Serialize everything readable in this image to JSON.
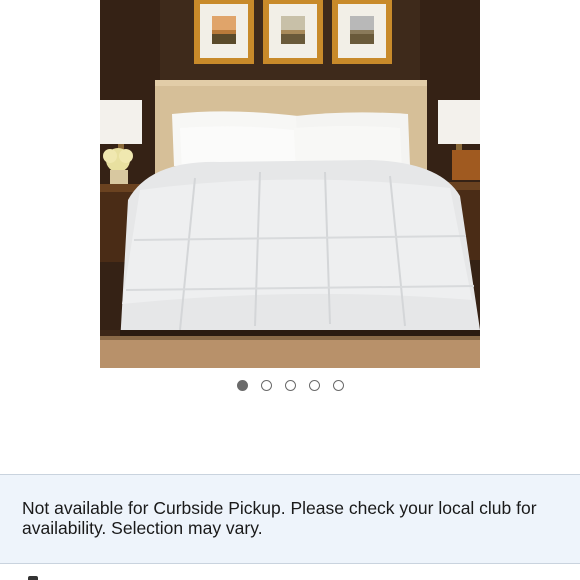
{
  "product": {
    "image_alt": "White down comforter on upholstered bed",
    "carousel": {
      "total": 5,
      "active_index": 0
    }
  },
  "notice": {
    "text": "Not available for Curbside Pickup. Please check your local club for availability. Selection may vary."
  },
  "colors": {
    "notice_bg": "#eef4fb",
    "dot": "#6a6a6a"
  }
}
